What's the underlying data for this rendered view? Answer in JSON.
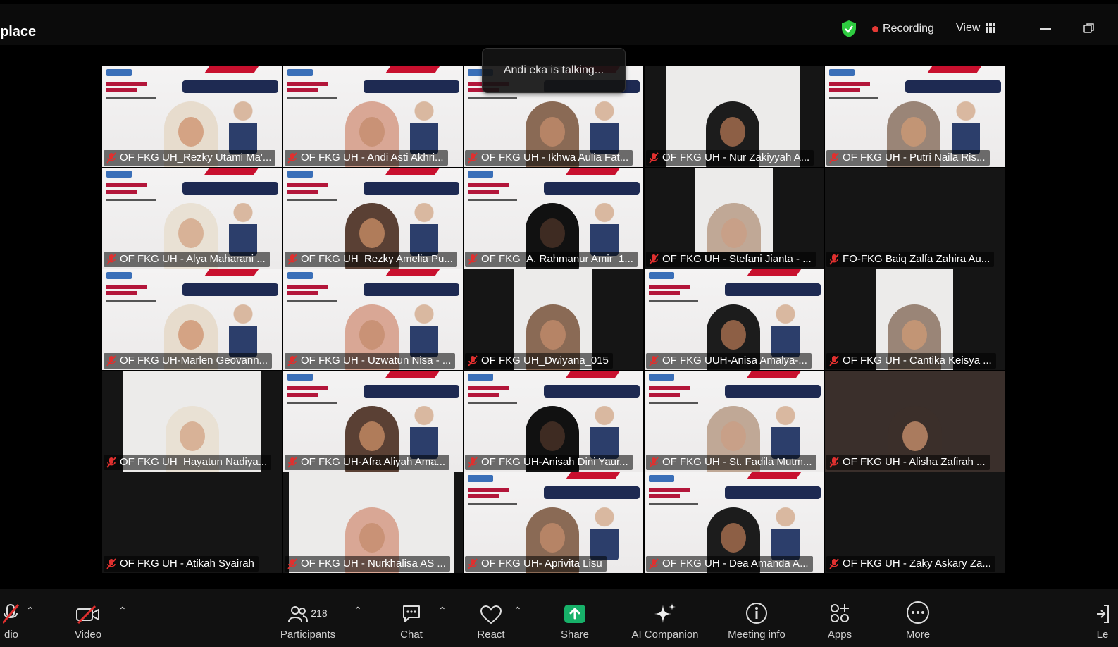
{
  "window": {
    "title": "place"
  },
  "topbar": {
    "recording_label": "Recording",
    "view_label": "View"
  },
  "talking_indicator": "Andi eka is talking...",
  "participants_tiles": [
    "OF FKG UH_Rezky Utami Ma'...",
    "OF FKG UH - Andi Asti Akhri...",
    "OF FKG UH - Ikhwa Aulia Fat...",
    "OF FKG UH - Nur Zakiyyah A...",
    "OF FKG UH - Putri Naila Ris...",
    "OF FKG UH - Alya Maharani ...",
    "OF FKG UH_Rezky Amelia Pu...",
    "OF FKG_A. Rahmanur Amir_1...",
    "OF FKG UH - Stefani Jianta - ...",
    "FO-FKG Baiq Zalfa Zahira Au...",
    "OF FKG UH-Marlen Geovann...",
    "OF FKG UH - Uzwatun Nisa - ...",
    "OF FKG UH_Dwiyana_015",
    "OF FKG UUH-Anisa Amalya-...",
    "OF FKG UH - Cantika Keisya ...",
    "OF FKG UH_Hayatun Nadiya...",
    "OF FKG UH-Afra Aliyah Ama...",
    "OF FKG UH-Anisah Dini Yaur...",
    "OF FKG UH - St. Fadila Mutm...",
    "OF FKG UH - Alisha Zafirah ...",
    "OF FKG UH - Atikah Syairah",
    "OF FKG UH - Nurkhalisa AS ...",
    "OF FKG UH- Aprivita Lisu",
    "OF FKG UH - Dea Amanda A...",
    "OF FKG UH - Zaky Askary Za..."
  ],
  "toolbar": {
    "audio_label": "dio",
    "video_label": "Video",
    "participants_label": "Participants",
    "participants_count": "218",
    "chat_label": "Chat",
    "react_label": "React",
    "share_label": "Share",
    "ai_label": "AI Companion",
    "info_label": "Meeting info",
    "apps_label": "Apps",
    "more_label": "More",
    "leave_label": "Le"
  },
  "colors": {
    "share_green": "#17b169",
    "recording_red": "#e53935",
    "shield_green": "#2ecc40",
    "muted_red": "#e0302f"
  }
}
